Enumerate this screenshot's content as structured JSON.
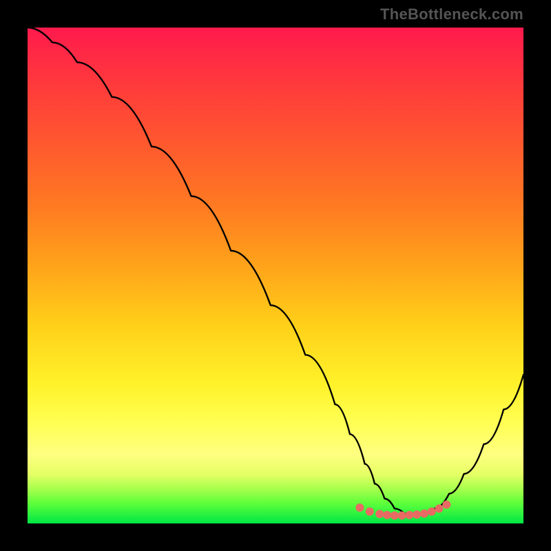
{
  "watermark": "TheBottleneck.com",
  "chart_data": {
    "type": "line",
    "title": "",
    "xlabel": "",
    "ylabel": "",
    "xlim": [
      0,
      100
    ],
    "ylim": [
      0,
      100
    ],
    "series": [
      {
        "name": "bottleneck-curve",
        "color": "#000000",
        "x": [
          0,
          5,
          10,
          17,
          25,
          33,
          41,
          49,
          56,
          62,
          65,
          68,
          70,
          72,
          74,
          76,
          78,
          80,
          82,
          85,
          88,
          92,
          96,
          100
        ],
        "y": [
          100,
          97,
          93,
          86,
          76,
          66,
          55,
          44,
          34,
          24,
          18,
          12,
          8,
          5,
          3,
          2,
          2,
          2,
          3,
          6,
          10,
          16,
          23,
          30
        ]
      }
    ],
    "markers": {
      "name": "highlight-dots",
      "color": "#e86b63",
      "radius": 6,
      "x": [
        67,
        69,
        71,
        72.5,
        74,
        75.5,
        77,
        78.5,
        80,
        81.5,
        83,
        84.5
      ],
      "y": [
        3.2,
        2.4,
        1.9,
        1.7,
        1.6,
        1.6,
        1.7,
        1.8,
        2.0,
        2.4,
        3.0,
        3.8
      ]
    },
    "background_gradient": {
      "top": "#ff1a4d",
      "mid": "#ffe433",
      "bottom": "#00e646"
    }
  }
}
